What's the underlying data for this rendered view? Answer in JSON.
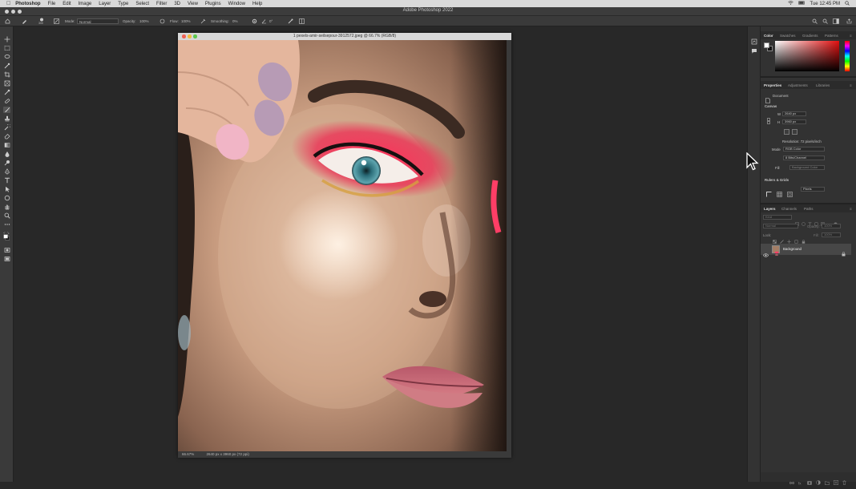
{
  "menubar": {
    "app_name": "Photoshop",
    "items": [
      "File",
      "Edit",
      "Image",
      "Layer",
      "Type",
      "Select",
      "Filter",
      "3D",
      "View",
      "Plugins",
      "Window",
      "Help"
    ],
    "clock": "Tue 12:45 PM"
  },
  "window": {
    "title": "Adobe Photoshop 2022"
  },
  "options_bar": {
    "brush_size": "300",
    "mode_label": "Mode:",
    "mode_value": "Normal",
    "opacity_label": "Opacity:",
    "opacity_value": "100%",
    "flow_label": "Flow:",
    "flow_value": "100%",
    "smoothing_label": "Smoothing:",
    "smoothing_value": "0%",
    "angle_value": "0°"
  },
  "document": {
    "tab_title": "1 pexels-amir-seilsepour-3912572.jpeg @ 66.7% (RGB/8)",
    "zoom": "66.67%",
    "info": "2640 px x 3960 px (72 ppi)"
  },
  "color_panel": {
    "tabs": [
      "Color",
      "Swatches",
      "Gradients",
      "Patterns"
    ],
    "active_tab": "Color",
    "foreground": "#ffffff",
    "background": "#111111"
  },
  "properties_panel": {
    "tabs": [
      "Properties",
      "Adjustments",
      "Libraries"
    ],
    "active_tab": "Properties",
    "doc_label": "Document",
    "canvas_heading": "Canvas",
    "width_label": "W",
    "width_value": "2640 px",
    "height_label": "H",
    "height_value": "3960 px",
    "resolution": "Resolution: 72 pixels/inch",
    "mode_label": "Mode",
    "mode_value": "RGB Color",
    "bits_value": "8 Bits/Channel",
    "fill_label": "Fill",
    "fill_value": "Background Color",
    "rulers_heading": "Rulers & Grids",
    "units_value": "Pixels"
  },
  "layers_panel": {
    "tabs": [
      "Layers",
      "Channels",
      "Paths"
    ],
    "active_tab": "Layers",
    "kind_label": "Kind",
    "blend_value": "Normal",
    "opacity_label": "Opacity:",
    "opacity_value": "100%",
    "lock_label": "Lock:",
    "fill_label": "Fill:",
    "fill_value": "100%",
    "layers": [
      {
        "name": "Background",
        "visible": true,
        "locked": true
      }
    ]
  },
  "colors": {
    "menubar": "#d9d9d9",
    "chrome": "#3a3a3a",
    "workspace": "#282828",
    "panel": "#323232"
  }
}
